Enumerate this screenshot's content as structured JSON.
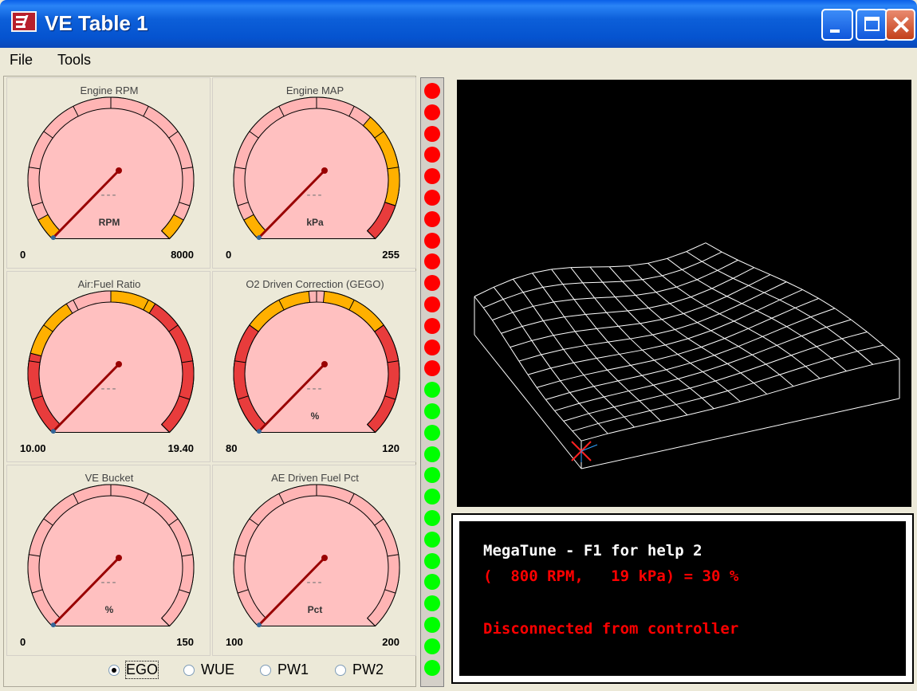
{
  "window": {
    "title": "VE Table 1"
  },
  "menu": [
    {
      "label": "File"
    },
    {
      "label": "Tools"
    }
  ],
  "gauges": [
    {
      "title": "Engine RPM",
      "units": "RPM",
      "value_text": "---",
      "min": "0",
      "max": "8000"
    },
    {
      "title": "Engine MAP",
      "units": "kPa",
      "value_text": "---",
      "min": "0",
      "max": "255"
    },
    {
      "title": "Air:Fuel Ratio",
      "units": "",
      "value_text": "---",
      "min": "10.00",
      "max": "19.40"
    },
    {
      "title": "O2 Driven Correction (GEGO)",
      "units": "%",
      "value_text": "---",
      "min": "80",
      "max": "120"
    },
    {
      "title": "VE Bucket",
      "units": "%",
      "value_text": "---",
      "min": "0",
      "max": "150"
    },
    {
      "title": "AE Driven Fuel Pct",
      "units": "Pct",
      "value_text": "---",
      "min": "100",
      "max": "200"
    }
  ],
  "leds": {
    "red_count": 14,
    "green_count": 14,
    "colors": {
      "red": "#ff0000",
      "green": "#00ff00"
    }
  },
  "console": {
    "line1": "MegaTune - F1 for help 2",
    "line2": "(  800 RPM,   19 kPa) = 30 %",
    "line3": "Disconnected from controller"
  },
  "radios": [
    {
      "label": "EGO",
      "selected": true
    },
    {
      "label": "WUE",
      "selected": false
    },
    {
      "label": "PW1",
      "selected": false
    },
    {
      "label": "PW2",
      "selected": false
    }
  ],
  "colors": {
    "gauge_face": "#ffc0c0",
    "needle": "#990000",
    "warn": "#ffb000",
    "danger": "#e83c3c",
    "console_text_white": "#ffffff",
    "console_text_red": "#ff0000"
  }
}
